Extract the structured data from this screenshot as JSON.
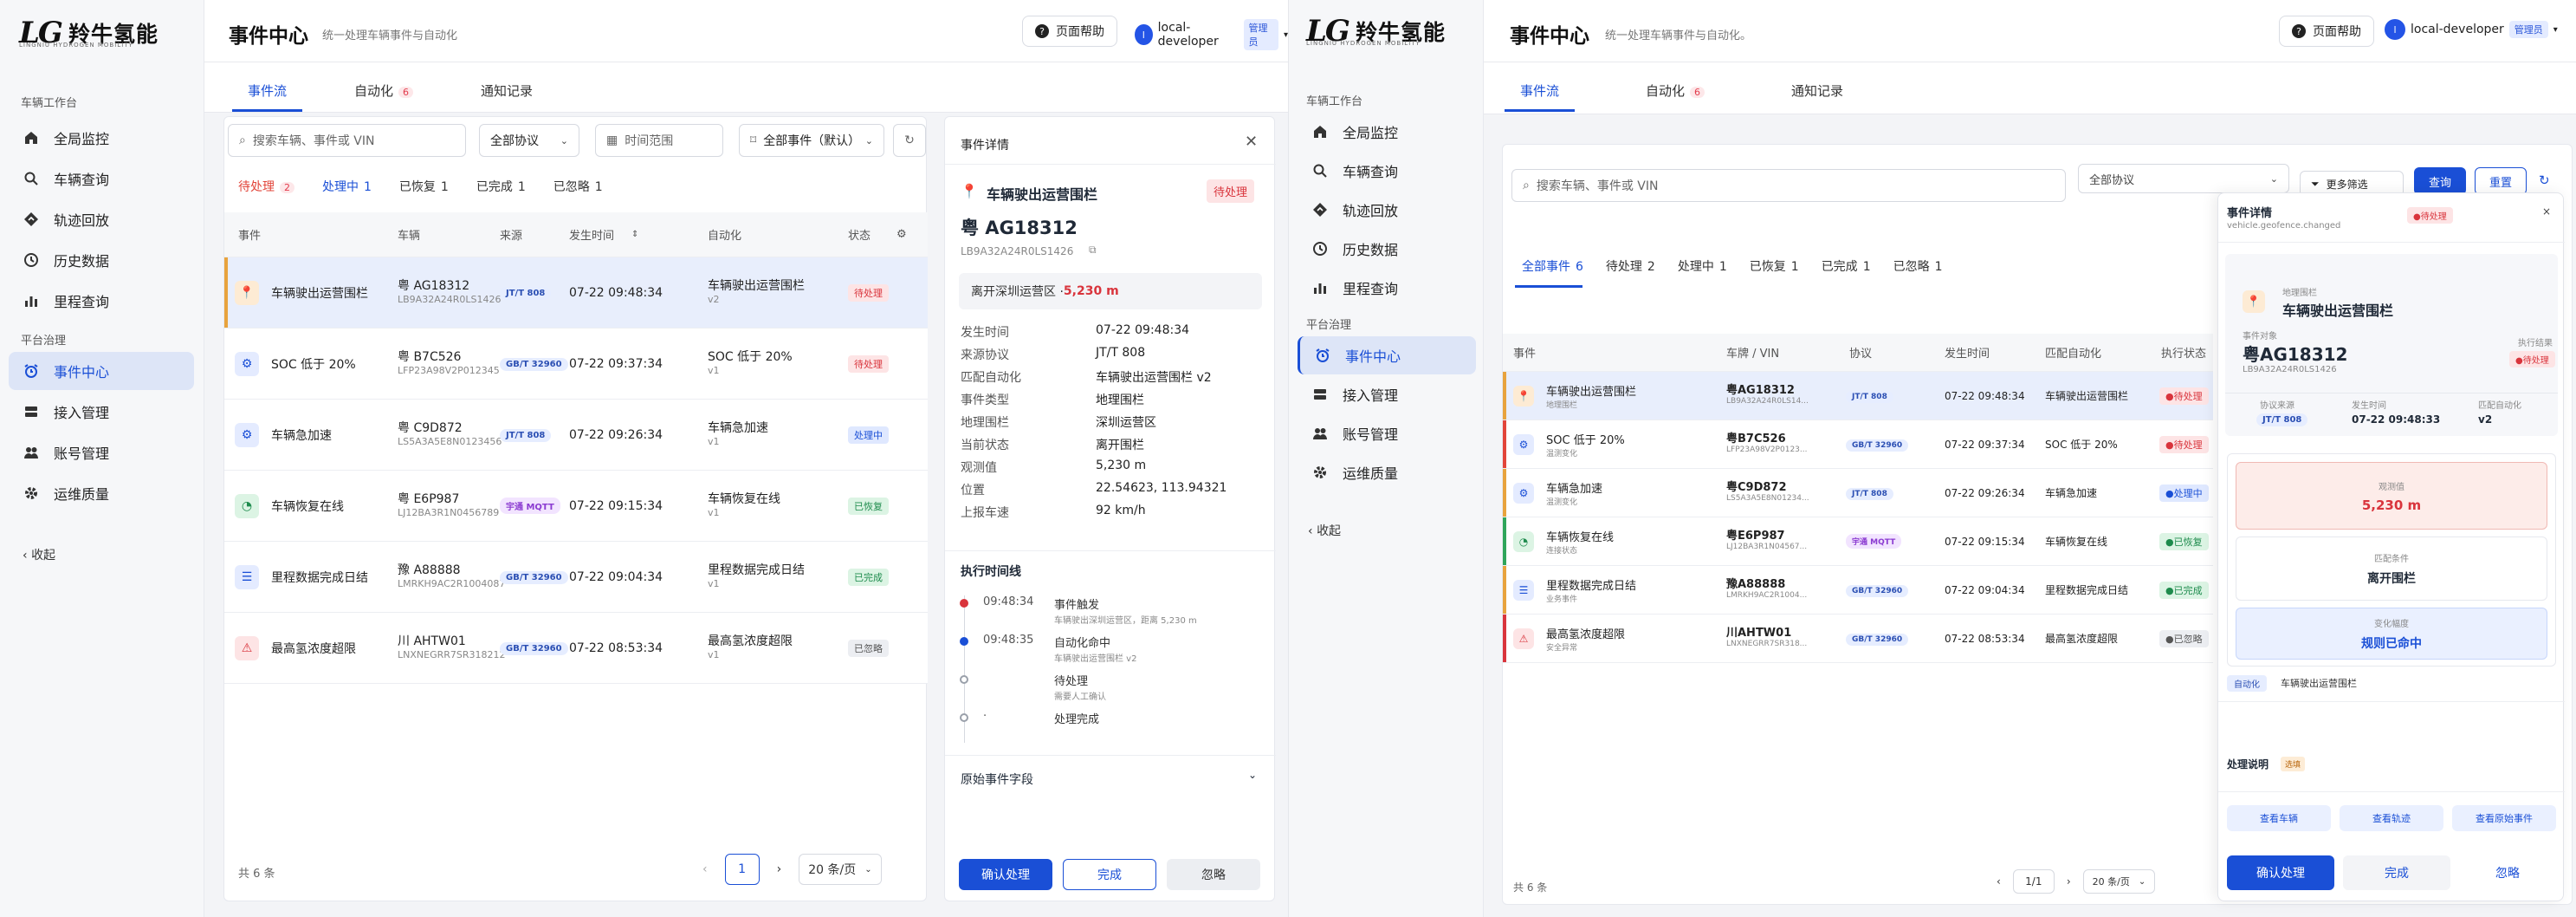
{
  "brand": {
    "mark": "LG",
    "name": "羚牛氢能",
    "sub": "LINGNIU HYDROGEN MOBILITY"
  },
  "sidebar": {
    "section1": "车辆工作台",
    "section2": "平台治理",
    "items": [
      "全局监控",
      "车辆查询",
      "轨迹回放",
      "历史数据",
      "里程查询",
      "事件中心",
      "接入管理",
      "账号管理",
      "运维质量"
    ],
    "collapse": "收起"
  },
  "header": {
    "title": "事件中心",
    "subtitle": "统一处理车辆事件与自动化",
    "help": "页面帮助",
    "user": "local-developer",
    "role": "管理员",
    "avatar": "l"
  },
  "tabs": [
    {
      "label": "事件流"
    },
    {
      "label": "自动化",
      "count": "6"
    },
    {
      "label": "通知记录"
    }
  ],
  "filters": {
    "search_placeholder": "搜索车辆、事件或 VIN",
    "protocol": "全部协议",
    "time": "时间范围",
    "events": "全部事件（默认）"
  },
  "stats": [
    {
      "label": "待处理",
      "count": "2"
    },
    {
      "label": "处理中",
      "count": "1"
    },
    {
      "label": "已恢复",
      "count": "1"
    },
    {
      "label": "已完成",
      "count": "1"
    },
    {
      "label": "已忽略",
      "count": "1"
    }
  ],
  "table": {
    "headers": [
      "事件",
      "车辆",
      "来源",
      "发生时间",
      "自动化",
      "状态"
    ],
    "rows": [
      {
        "event": "车辆驶出运营围栏",
        "plate": "粤 AG18312",
        "vin": "LB9A32A24R0LS1426",
        "proto": "JT/T 808",
        "time": "07-22 09:48:34",
        "auto": "车辆驶出运营围栏",
        "ver": "v2",
        "status": "待处理"
      },
      {
        "event": "SOC 低于 20%",
        "plate": "粤 B7C526",
        "vin": "LFP23A98V2P012345",
        "proto": "GB/T 32960",
        "time": "07-22 09:37:34",
        "auto": "SOC 低于 20%",
        "ver": "v1",
        "status": "待处理"
      },
      {
        "event": "车辆急加速",
        "plate": "粤 C9D872",
        "vin": "LS5A3A5E8N0123456",
        "proto": "JT/T 808",
        "time": "07-22 09:26:34",
        "auto": "车辆急加速",
        "ver": "v1",
        "status": "处理中"
      },
      {
        "event": "车辆恢复在线",
        "plate": "粤 E6P987",
        "vin": "LJ12BA3R1N0456789",
        "proto": "宇通 MQTT",
        "time": "07-22 09:15:34",
        "auto": "车辆恢复在线",
        "ver": "v1",
        "status": "已恢复"
      },
      {
        "event": "里程数据完成日结",
        "plate": "豫 A88888",
        "vin": "LMRKH9AC2R1004087",
        "proto": "GB/T 32960",
        "time": "07-22 09:04:34",
        "auto": "里程数据完成日结",
        "ver": "v1",
        "status": "已完成"
      },
      {
        "event": "最高氢浓度超限",
        "plate": "川 AHTW01",
        "vin": "LNXNEGRR7SR318212",
        "proto": "GB/T 32960",
        "time": "07-22 08:53:34",
        "auto": "最高氢浓度超限",
        "ver": "v1",
        "status": "已忽略"
      }
    ]
  },
  "pager": {
    "total": "共 6 条",
    "page": "1",
    "size": "20 条/页"
  },
  "detail": {
    "header": "事件详情",
    "event": "车辆驶出运营围栏",
    "status": "待处理",
    "plate": "粤 AG18312",
    "vin": "LB9A32A24R0LS1426",
    "hint": "离开深圳运营区 · ",
    "hint_val": "5,230 m",
    "fields": [
      {
        "k": "发生时间",
        "v": "07-22 09:48:34"
      },
      {
        "k": "来源协议",
        "v": "JT/T 808"
      },
      {
        "k": "匹配自动化",
        "v": "车辆驶出运营围栏 v2"
      },
      {
        "k": "事件类型",
        "v": "地理围栏"
      },
      {
        "k": "地理围栏",
        "v": "深圳运营区"
      },
      {
        "k": "当前状态",
        "v": "离开围栏"
      },
      {
        "k": "观测值",
        "v": "5,230 m"
      },
      {
        "k": "位置",
        "v": "22.54623, 113.94321"
      },
      {
        "k": "上报车速",
        "v": "92 km/h"
      }
    ],
    "timeline_title": "执行时间线",
    "timeline": [
      {
        "t": "09:48:34",
        "a": "事件触发",
        "b": "车辆驶出深圳运营区，距离 5,230 m"
      },
      {
        "t": "09:48:35",
        "a": "自动化命中",
        "b": "车辆驶出运营围栏 v2"
      },
      {
        "t": "",
        "a": "待处理",
        "b": "需要人工确认"
      },
      {
        "t": "·",
        "a": "处理完成",
        "b": ""
      }
    ],
    "raw": "原始事件字段",
    "btn_confirm": "确认处理",
    "btn_done": "完成",
    "btn_ignore": "忽略"
  },
  "right": {
    "subtitle": "统一处理车辆事件与自动化。",
    "query": "查询",
    "reset": "重置",
    "more": "更多筛选",
    "stats": [
      {
        "label": "全部事件",
        "count": "6"
      },
      {
        "label": "待处理",
        "count": "2"
      },
      {
        "label": "处理中",
        "count": "1"
      },
      {
        "label": "已恢复",
        "count": "1"
      },
      {
        "label": "已完成",
        "count": "1"
      },
      {
        "label": "已忽略",
        "count": "1"
      }
    ],
    "headers": [
      "事件",
      "车牌 / VIN",
      "协议",
      "发生时间",
      "匹配自动化",
      "执行状态"
    ],
    "rows": [
      {
        "event": "车辆驶出运营围栏",
        "cat": "地理围栏",
        "plate": "粤AG18312",
        "vin": "LB9A32A24R0LS14...",
        "proto": "JT/T 808",
        "time": "07-22 09:48:34",
        "auto": "车辆驶出运营围栏",
        "status": "●待处理"
      },
      {
        "event": "SOC 低于 20%",
        "cat": "温测变化",
        "plate": "粤B7C526",
        "vin": "LFP23A98V2P0123...",
        "proto": "GB/T 32960",
        "time": "07-22 09:37:34",
        "auto": "SOC 低于 20%",
        "status": "●待处理"
      },
      {
        "event": "车辆急加速",
        "cat": "温测变化",
        "plate": "粤C9D872",
        "vin": "LS5A3A5E8N01234...",
        "proto": "JT/T 808",
        "time": "07-22 09:26:34",
        "auto": "车辆急加速",
        "status": "●处理中"
      },
      {
        "event": "车辆恢复在线",
        "cat": "连接状态",
        "plate": "粤E6P987",
        "vin": "LJ12BA3R1N04567...",
        "proto": "宇通 MQTT",
        "time": "07-22 09:15:34",
        "auto": "车辆恢复在线",
        "status": "●已恢复"
      },
      {
        "event": "里程数据完成日结",
        "cat": "业务事件",
        "plate": "豫A88888",
        "vin": "LMRKH9AC2R1004...",
        "proto": "GB/T 32960",
        "time": "07-22 09:04:34",
        "auto": "里程数据完成日结",
        "status": "●已完成"
      },
      {
        "event": "最高氢浓度超限",
        "cat": "安全异常",
        "plate": "川AHTW01",
        "vin": "LNXNEGRR7SR318...",
        "proto": "GB/T 32960",
        "time": "07-22 08:53:34",
        "auto": "最高氢浓度超限",
        "status": "●已忽略"
      }
    ],
    "pager": {
      "total": "共 6 条",
      "page": "1/1",
      "size": "20 条/页"
    },
    "drawer": {
      "title": "事件详情",
      "code": "vehicle.geofence.changed",
      "status": "●待处理",
      "cat": "地理围栏",
      "event": "车辆驶出运营围栏",
      "obj_label": "事件对象",
      "plate": "粤AG18312",
      "vin": "LB9A32A24R0LS1426",
      "exec_label": "执行结果",
      "exec_status": "●待处理",
      "meta": [
        {
          "k": "协议来源",
          "v": "JT/T 808"
        },
        {
          "k": "发生时间",
          "v": "07-22 09:48:33"
        },
        {
          "k": "匹配自动化",
          "v": "v2"
        }
      ],
      "cards": [
        {
          "k": "观测值",
          "v": "5,230 m"
        },
        {
          "k": "匹配条件",
          "v": "离开围栏"
        },
        {
          "k": "变化幅度",
          "v": "规则已命中"
        }
      ],
      "auto_tag": "自动化",
      "auto_name": "车辆驶出运营围栏",
      "note_label": "处理说明",
      "note_tag": "选填",
      "links": [
        "查看车辆",
        "查看轨迹",
        "查看原始事件"
      ],
      "btn_confirm": "确认处理",
      "btn_done": "完成",
      "btn_ignore": "忽略"
    }
  }
}
